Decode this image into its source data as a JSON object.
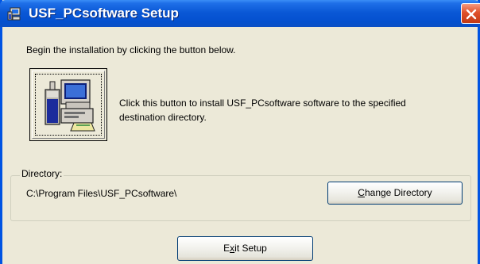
{
  "window": {
    "title": "USF_PCsoftware Setup",
    "title_icon": "setup-icon",
    "close_icon": "close-icon"
  },
  "main": {
    "instruction": "Begin the installation by clicking the button below.",
    "install_button_icon": "computer-install-icon",
    "install_description": "Click this button to install USF_PCsoftware software to the specified destination directory."
  },
  "directory": {
    "legend": "Directory:",
    "path": "C:\\Program Files\\USF_PCsoftware\\",
    "change_button": {
      "mnemonic": "C",
      "rest": "hange Directory"
    }
  },
  "footer": {
    "exit_button": {
      "before": "E",
      "mnemonic": "x",
      "after": "it Setup"
    }
  },
  "colors": {
    "titlebar": "#0a58d6",
    "window_bg": "#ece9d8",
    "close_button": "#e0502a"
  }
}
